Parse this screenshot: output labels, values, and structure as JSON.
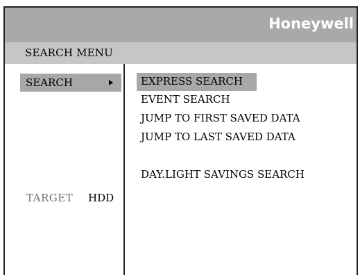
{
  "header": {
    "brand": "Honeywell"
  },
  "title_bar": {
    "title": "SEARCH MENU"
  },
  "left_panel": {
    "selected_item": "SEARCH",
    "target_label": "TARGET",
    "target_value": "HDD"
  },
  "menu": {
    "items": [
      {
        "label": "EXPRESS SEARCH",
        "selected": true
      },
      {
        "label": "EVENT SEARCH",
        "selected": false
      },
      {
        "label": "JUMP TO FIRST SAVED DATA",
        "selected": false
      },
      {
        "label": "JUMP TO LAST SAVED DATA",
        "selected": false
      },
      {
        "label": "DAY.LIGHT SAVINGS SEARCH",
        "selected": false
      }
    ]
  },
  "colors": {
    "header_bg": "#a9a9a9",
    "title_bg": "#c6c6c6",
    "highlight": "#a8a8a8",
    "dim_text": "#6e6e6e"
  },
  "icons": {
    "submenu": "right-arrow-icon"
  }
}
